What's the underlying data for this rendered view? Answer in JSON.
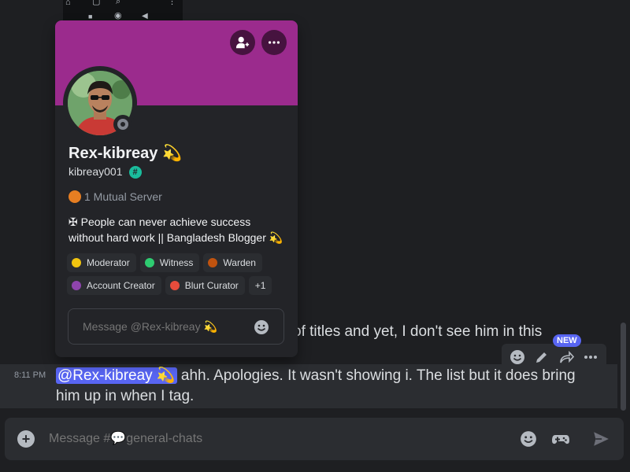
{
  "nav_strip": {
    "icons": [
      "home-icon",
      "square-icon",
      "search-icon",
      "more-vertical-icon",
      "stop-icon",
      "record-icon",
      "back-icon"
    ]
  },
  "profile": {
    "display_name": "Rex-kibreay 💫",
    "username": "kibreay001",
    "badge_symbol": "#",
    "mutual_servers": "1 Mutual Server",
    "bio": "✠ People can never achieve success without hard work || Bangladesh Blogger 💫",
    "roles": [
      {
        "label": "Moderator",
        "color": "#f1c40f"
      },
      {
        "label": "Witness",
        "color": "#2ecc71"
      },
      {
        "label": "Warden",
        "color": "#c0530f"
      },
      {
        "label": "Account Creator",
        "color": "#8e44ad"
      },
      {
        "label": "Blurt Curator",
        "color": "#e74c3c"
      }
    ],
    "more_roles": "+1",
    "dm_placeholder": "Message @Rex-kibreay 💫",
    "banner_color": "#9b2b8d"
  },
  "chat": {
    "partial_line": "of titles and yet, I don't see him in this",
    "message": {
      "time": "8:11 PM",
      "mention": "@Rex-kibreay 💫",
      "text": " ahh. Apologies. It wasn't showing i. The list but it does bring him up in when I tag."
    },
    "new_badge": "NEW",
    "composer_placeholder": "Message #💬general-chats"
  }
}
